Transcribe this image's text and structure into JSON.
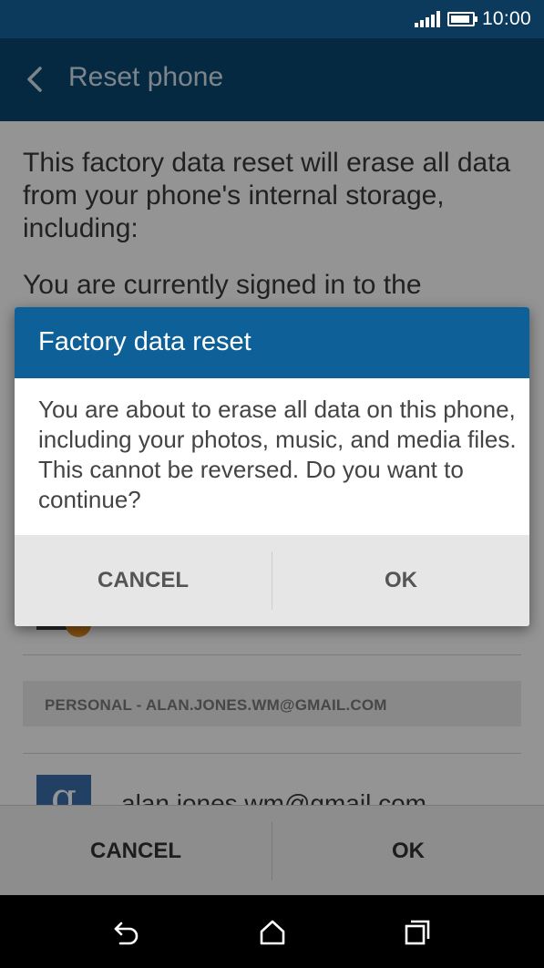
{
  "status_bar": {
    "time": "10:00",
    "signal_icon": "signal-bars-icon",
    "battery_icon": "battery-icon",
    "battery_level": 0.9
  },
  "app_bar": {
    "back_icon": "back-arrow-icon",
    "title": "Reset phone"
  },
  "content": {
    "intro_text": "This factory data reset will erase all data from your phone's internal storage, including:",
    "signed_in_text": "You are currently signed in to the",
    "section_header": "PERSONAL - ALAN.JONES.WM@GMAIL.COM",
    "google_icon_glyph": "g",
    "account_email": "alan.jones.wm@gmail.com"
  },
  "bottom_bar": {
    "cancel_label": "CANCEL",
    "ok_label": "OK"
  },
  "dialog": {
    "title": "Factory data reset",
    "message": "You are about to erase all data on this phone, including your photos, music, and media files. This cannot be reversed. Do you want to continue?",
    "cancel_label": "CANCEL",
    "ok_label": "OK"
  },
  "nav_bar": {
    "back_icon": "nav-back-icon",
    "home_icon": "home-icon",
    "recents_icon": "recent-apps-icon"
  },
  "colors": {
    "status_bar": "#0b3a5c",
    "app_bar": "#0b4873",
    "dialog_header": "#0e6098",
    "google_blue": "#3b6dad"
  }
}
